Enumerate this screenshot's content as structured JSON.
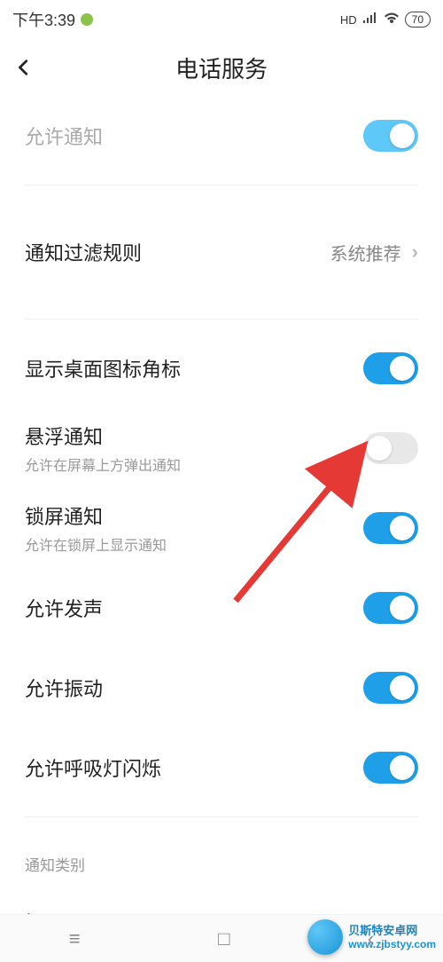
{
  "status": {
    "time": "下午3:39",
    "hd": "HD",
    "battery": "70"
  },
  "header": {
    "title": "电话服务"
  },
  "rows": {
    "allow_notify": {
      "label": "允许通知",
      "on": true
    },
    "filter_rule": {
      "label": "通知过滤规则",
      "value": "系统推荐"
    },
    "show_badge": {
      "label": "显示桌面图标角标",
      "on": true
    },
    "float_notify": {
      "label": "悬浮通知",
      "sublabel": "允许在屏幕上方弹出通知",
      "on": false
    },
    "lock_notify": {
      "label": "锁屏通知",
      "sublabel": "允许在锁屏上显示通知",
      "on": true
    },
    "allow_sound": {
      "label": "允许发声",
      "on": true
    },
    "allow_vibrate": {
      "label": "允许振动",
      "on": true
    },
    "allow_led": {
      "label": "允许呼吸灯闪烁",
      "on": true
    }
  },
  "section": {
    "category": "通知类别",
    "reminder": "提醒"
  },
  "watermark": {
    "name": "贝斯特安卓网",
    "url": "www.zjbstyy.com"
  }
}
